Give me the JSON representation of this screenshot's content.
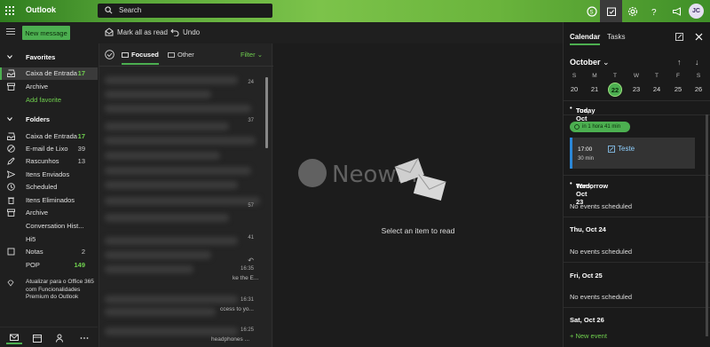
{
  "app": {
    "title": "Outlook",
    "avatar_initials": "JC",
    "search_placeholder": "Search"
  },
  "colors": {
    "accent": "#4caf50",
    "topbar": "#5aa83a",
    "event_bar": "#2b88d8"
  },
  "commands": {
    "new_message": "New message",
    "mark_all_read": "Mark all as read",
    "undo": "Undo"
  },
  "sidebar": {
    "favorites_header": "Favorites",
    "favorites": [
      {
        "label": "Caixa de Entrada",
        "count": "17",
        "icon": "inbox-icon"
      },
      {
        "label": "Archive",
        "count": "",
        "icon": "archive-icon"
      }
    ],
    "add_favorite": "Add favorite",
    "folders_header": "Folders",
    "folders": [
      {
        "label": "Caixa de Entrada",
        "count": "17",
        "icon": "inbox-icon"
      },
      {
        "label": "E-mail de Lixo",
        "count": "39",
        "icon": "junk-icon"
      },
      {
        "label": "Rascunhos",
        "count": "13",
        "icon": "pencil-icon"
      },
      {
        "label": "Itens Enviados",
        "count": "",
        "icon": "send-icon"
      },
      {
        "label": "Scheduled",
        "count": "",
        "icon": "clock-icon"
      },
      {
        "label": "Itens Eliminados",
        "count": "",
        "icon": "trash-icon"
      },
      {
        "label": "Archive",
        "count": "",
        "icon": "archive-icon"
      },
      {
        "label": "Conversation Hist...",
        "count": "",
        "icon": ""
      },
      {
        "label": "Hi5",
        "count": "",
        "icon": ""
      },
      {
        "label": "Notas",
        "count": "2",
        "icon": "note-icon"
      },
      {
        "label": "POP",
        "count": "149",
        "icon": ""
      }
    ],
    "upgrade": "Atualizar para o Office 365 com Funcionalidades Premium do Outlook"
  },
  "message_list": {
    "tab_focused": "Focused",
    "tab_other": "Other",
    "filter": "Filter",
    "times": [
      "24",
      "37",
      "57",
      "41",
      "16:35",
      "16:31",
      "16:25"
    ],
    "snippets": [
      "ke the E...",
      "ccess to yo...",
      "headphones ..."
    ]
  },
  "reading_pane": {
    "watermark": "Neowin",
    "empty_text": "Select an item to read"
  },
  "calendar": {
    "tab_calendar": "Calendar",
    "tab_tasks": "Tasks",
    "month": "October",
    "weekdays": [
      "S",
      "M",
      "T",
      "W",
      "T",
      "F",
      "S"
    ],
    "week_days": [
      "20",
      "21",
      "22",
      "23",
      "24",
      "25",
      "26"
    ],
    "today_day": "22",
    "agenda": {
      "today_label": "Today",
      "today_date": "Tue, Oct 22",
      "reminder": "in 1 hora 41 min",
      "event": {
        "time": "17:00",
        "duration": "30 min",
        "title": "Teste"
      },
      "tomorrow_label": "Tomorrow",
      "tomorrow_date": "Wed, Oct 23",
      "no_events": "No events scheduled",
      "day3": "Thu, Oct 24",
      "day4": "Fri, Oct 25",
      "day5": "Sat, Oct 26"
    },
    "new_event": "+ New event"
  }
}
